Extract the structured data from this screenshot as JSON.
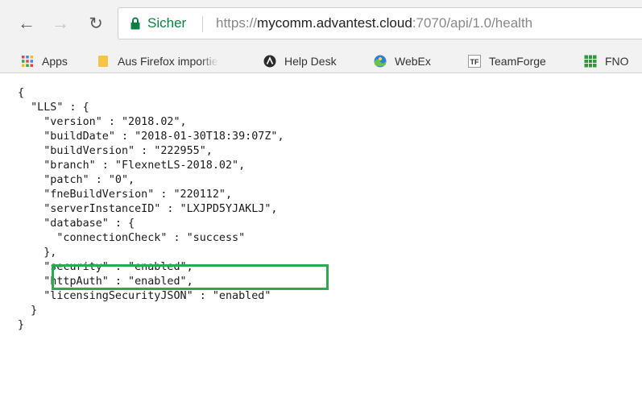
{
  "browser": {
    "nav": {
      "back_icon": "arrow-left-icon",
      "forward_icon": "arrow-right-icon",
      "reload_icon": "reload-icon"
    },
    "address_bar": {
      "secure_label": "Sicher",
      "url_scheme": "https://",
      "url_host": "mycomm.advantest.cloud",
      "url_rest": ":7070/api/1.0/health",
      "secure_color": "#0b8043"
    },
    "bookmarks": [
      {
        "label": "Apps",
        "icon": "apps-grid-icon"
      },
      {
        "label": "Aus Firefox importiert",
        "icon": "folder-icon"
      },
      {
        "label": "Help Desk",
        "icon": "helpdesk-icon"
      },
      {
        "label": "WebEx",
        "icon": "webex-globe-icon"
      },
      {
        "label": "TeamForge",
        "icon": "teamforge-icon"
      },
      {
        "label": "FNO",
        "icon": "fno-grid-icon"
      }
    ]
  },
  "json_lines": [
    "{",
    "  \"LLS\" : {",
    "    \"version\" : \"2018.02\",",
    "    \"buildDate\" : \"2018-01-30T18:39:07Z\",",
    "    \"buildVersion\" : \"222955\",",
    "    \"branch\" : \"FlexnetLS-2018.02\",",
    "    \"patch\" : \"0\",",
    "    \"fneBuildVersion\" : \"220112\",",
    "    \"serverInstanceID\" : \"LXJPD5YJAKLJ\",",
    "    \"database\" : {",
    "      \"connectionCheck\" : \"success\"",
    "    },",
    "    \"security\" : \"enabled\",",
    "    \"httpAuth\" : \"enabled\",",
    "    \"licensingSecurityJSON\" : \"enabled\"",
    "  }",
    "}"
  ],
  "highlight_color": "#2da94f"
}
